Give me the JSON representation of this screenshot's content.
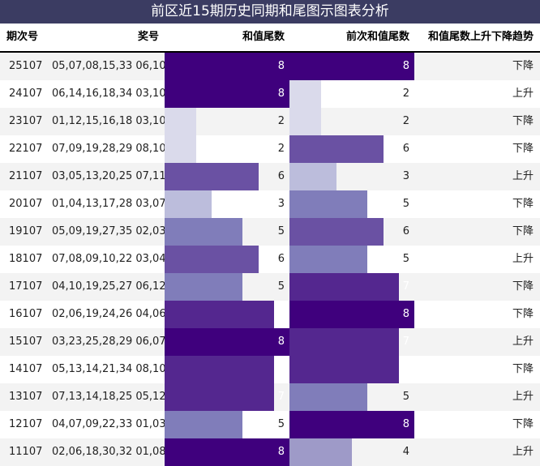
{
  "title": "前区近15期历史同期和尾图示图表分析",
  "headers": {
    "period": "期次号",
    "numbers": "奖号",
    "tail": "和值尾数",
    "prev_tail": "前次和值尾数",
    "trend": "和值尾数上升下降趋势"
  },
  "colors": {
    "title_bg": "#3b3c62",
    "bar_scale": [
      "#ffffff",
      "#f2f0f7",
      "#dadaeb",
      "#bcbddc",
      "#9e9ac8",
      "#807dba",
      "#6a51a3",
      "#54278f",
      "#3f007d"
    ]
  },
  "chart_data": {
    "type": "table",
    "title": "前区近15期历史同期和尾图示图表分析",
    "value_max": 8,
    "rows": [
      {
        "period": "25107",
        "numbers": "05,07,08,15,33 06,10",
        "tail": "8",
        "prev_tail": "8",
        "trend": "下降"
      },
      {
        "period": "24107",
        "numbers": "06,14,16,18,34 03,10",
        "tail": "8",
        "prev_tail": "2",
        "trend": "上升"
      },
      {
        "period": "23107",
        "numbers": "01,12,15,16,18 03,10",
        "tail": "2",
        "prev_tail": "2",
        "trend": "下降"
      },
      {
        "period": "22107",
        "numbers": "07,09,19,28,29 08,10",
        "tail": "2",
        "prev_tail": "6",
        "trend": "下降"
      },
      {
        "period": "21107",
        "numbers": "03,05,13,20,25 07,11",
        "tail": "6",
        "prev_tail": "3",
        "trend": "上升"
      },
      {
        "period": "20107",
        "numbers": "01,04,13,17,28 03,07",
        "tail": "3",
        "prev_tail": "5",
        "trend": "下降"
      },
      {
        "period": "19107",
        "numbers": "05,09,19,27,35 02,03",
        "tail": "5",
        "prev_tail": "6",
        "trend": "下降"
      },
      {
        "period": "18107",
        "numbers": "07,08,09,10,22 03,04",
        "tail": "6",
        "prev_tail": "5",
        "trend": "上升"
      },
      {
        "period": "17107",
        "numbers": "04,10,19,25,27 06,12",
        "tail": "5",
        "prev_tail": "7",
        "trend": "下降"
      },
      {
        "period": "16107",
        "numbers": "02,06,19,24,26 04,06",
        "tail": "7",
        "prev_tail": "8",
        "trend": "下降"
      },
      {
        "period": "15107",
        "numbers": "03,23,25,28,29 06,07",
        "tail": "8",
        "prev_tail": "7",
        "trend": "上升"
      },
      {
        "period": "14107",
        "numbers": "05,13,14,21,34 08,10",
        "tail": "7",
        "prev_tail": "7",
        "trend": "下降"
      },
      {
        "period": "13107",
        "numbers": "07,13,14,18,25 05,12",
        "tail": "7",
        "prev_tail": "5",
        "trend": "上升"
      },
      {
        "period": "12107",
        "numbers": "04,07,09,22,33 01,03",
        "tail": "5",
        "prev_tail": "8",
        "trend": "下降"
      },
      {
        "period": "11107",
        "numbers": "02,06,18,30,32 01,08",
        "tail": "8",
        "prev_tail": "4",
        "trend": "上升"
      }
    ]
  }
}
